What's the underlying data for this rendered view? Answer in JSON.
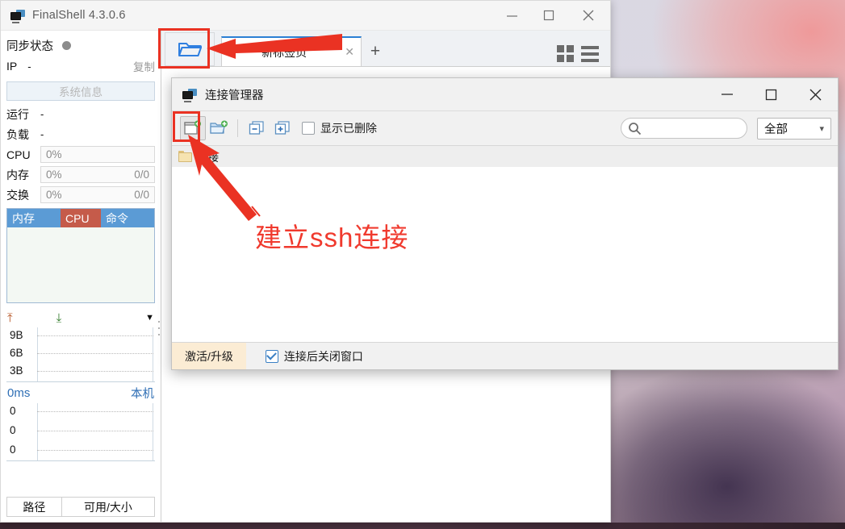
{
  "app": {
    "title": "FinalShell 4.3.0.6",
    "icon": "monitor-icon",
    "window_buttons": [
      {
        "name": "minimize",
        "glyph": "—"
      },
      {
        "name": "maximize",
        "glyph": "▢"
      },
      {
        "name": "close",
        "glyph": "✕"
      }
    ]
  },
  "sidebar": {
    "sync": {
      "label": "同步状态",
      "status_dot": "idle"
    },
    "ip": {
      "key": "IP",
      "value": "-",
      "copy_label": "复制"
    },
    "sysinfo_button": "系统信息",
    "metrics": [
      {
        "key": "运行",
        "value": "-",
        "type": "plain"
      },
      {
        "key": "负载",
        "value": "-",
        "type": "plain"
      },
      {
        "key": "CPU",
        "value": "0%",
        "right": "",
        "type": "box"
      },
      {
        "key": "内存",
        "value": "0%",
        "right": "0/0",
        "type": "box"
      },
      {
        "key": "交换",
        "value": "0%",
        "right": "0/0",
        "type": "box"
      }
    ],
    "process_table": {
      "columns": [
        "内存",
        "CPU",
        "命令"
      ],
      "rows": []
    },
    "network": {
      "upload_icon": "arrow-up-icon",
      "download_icon": "arrow-down-icon",
      "expand_icon": "caret-down-icon",
      "y_labels": [
        "9B",
        "6B",
        "3B"
      ]
    },
    "latency": {
      "value": "0ms",
      "host_label": "本机",
      "y_labels": [
        "0",
        "0",
        "0"
      ]
    },
    "bottom_tabs": [
      {
        "label": "路径"
      },
      {
        "label": "可用/大小"
      }
    ]
  },
  "tabstrip": {
    "open_button_icon": "open-folder-icon",
    "tabs": [
      {
        "label": "新标签页",
        "close_glyph": "✕",
        "active": true
      }
    ],
    "add_tab_glyph": "+",
    "right_icons": [
      "grid-view-icon",
      "menu-list-icon"
    ]
  },
  "dialog": {
    "title": "连接管理器",
    "icon": "monitor-icon",
    "window_buttons": [
      {
        "name": "minimize",
        "glyph": "—"
      },
      {
        "name": "maximize",
        "glyph": "▢"
      },
      {
        "name": "close",
        "glyph": "✕"
      }
    ],
    "toolbar": {
      "new_connection_icon": "new-connection-icon",
      "new_folder_icon": "new-folder-icon",
      "collapse_all_icon": "collapse-all-icon",
      "expand_all_icon": "expand-all-icon",
      "show_deleted_label": "显示已删除",
      "show_deleted_checked": false,
      "search_placeholder": "",
      "search_value": "",
      "search_icon": "search-icon",
      "filter_value": "全部",
      "filter_chevron": "chevron-down-icon"
    },
    "tree": {
      "items": [
        {
          "label": "连接",
          "icon": "folder-icon"
        }
      ]
    },
    "footer": {
      "activate_label": "激活/升级",
      "close_after_connect_label": "连接后关闭窗口",
      "close_after_connect_checked": true
    }
  },
  "annotations": {
    "text": "建立ssh连接",
    "color": "#f03a2e",
    "highlight_color": "#ea3223",
    "highlights": [
      "open-session-button",
      "new-connection-button"
    ]
  }
}
